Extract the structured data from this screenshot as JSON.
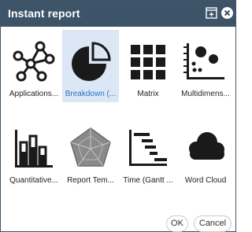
{
  "dialog": {
    "title": "Instant report"
  },
  "tiles": [
    {
      "label": "Applications...",
      "icon": "network-graph-icon"
    },
    {
      "label": "Breakdown (...",
      "icon": "pie-chart-icon",
      "selected": true
    },
    {
      "label": "Matrix",
      "icon": "grid-matrix-icon"
    },
    {
      "label": "Multidimens...",
      "icon": "bubble-chart-icon"
    },
    {
      "label": "Quantitative...",
      "icon": "bar-chart-icon"
    },
    {
      "label": "Report Tem...",
      "icon": "radar-chart-icon"
    },
    {
      "label": "Time (Gantt ...",
      "icon": "gantt-chart-icon"
    },
    {
      "label": "Word Cloud",
      "icon": "cloud-icon"
    }
  ],
  "buttons": {
    "ok": "OK",
    "cancel": "Cancel"
  },
  "colors": {
    "titlebar": "#3d5368",
    "selected_bg": "#dbe7f5",
    "selected_text": "#2e6fc4",
    "icon": "#1a1a1a"
  }
}
